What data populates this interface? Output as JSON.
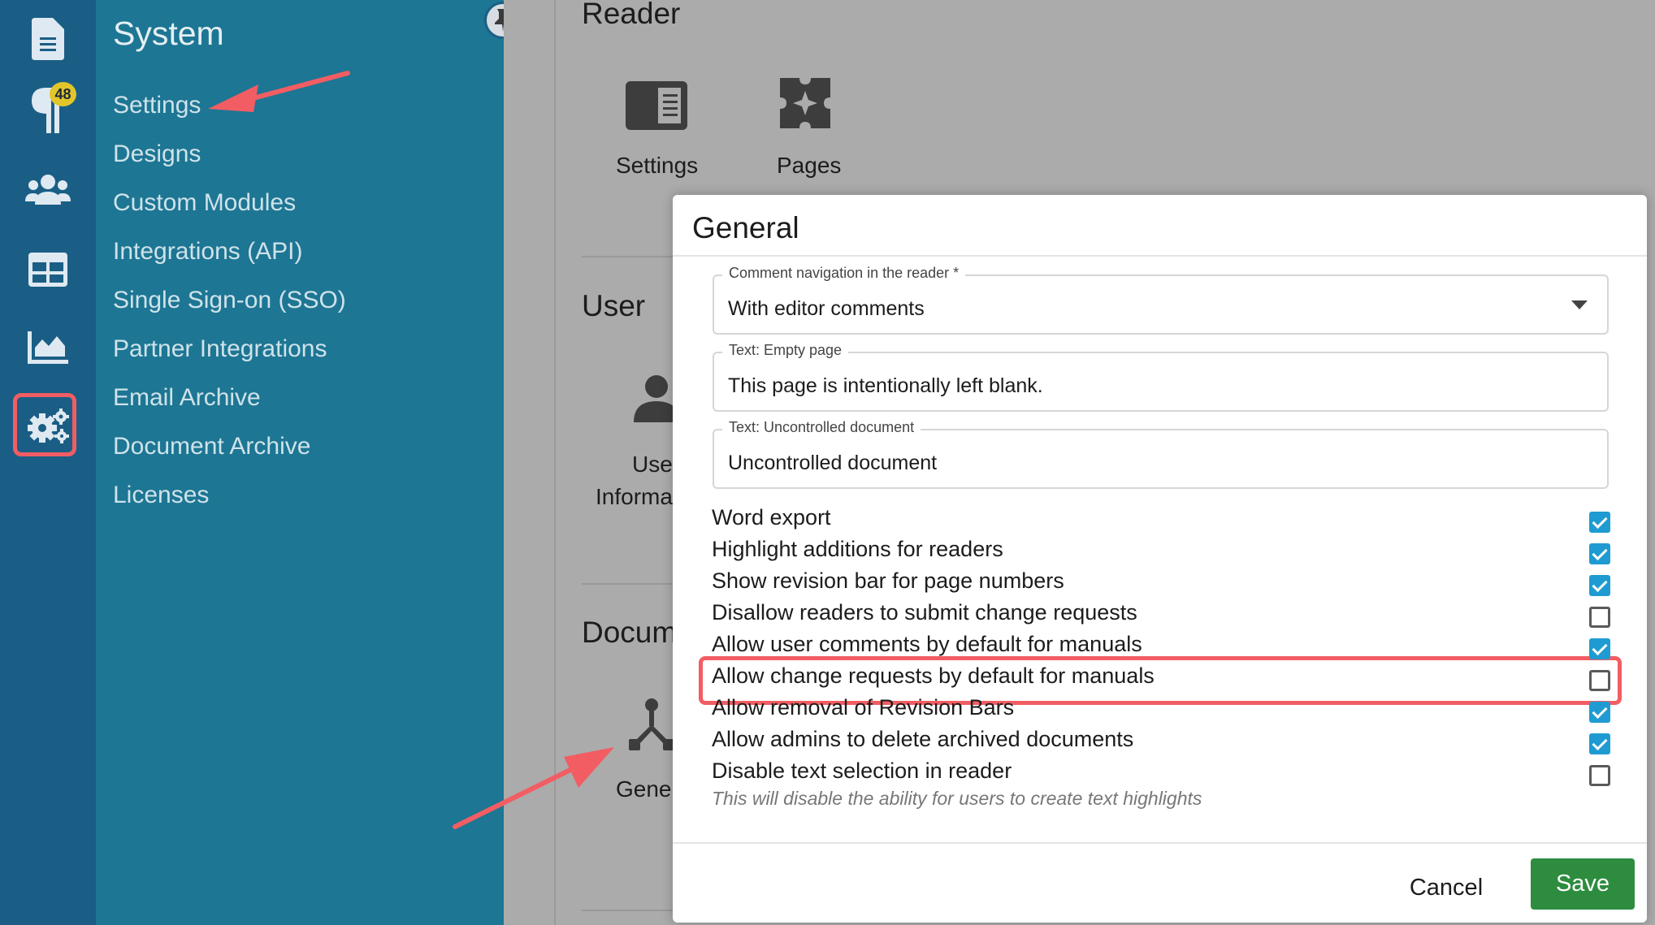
{
  "rail": {
    "notification_count": "48",
    "items": [
      {
        "name": "documents-icon"
      },
      {
        "name": "change-requests-icon"
      },
      {
        "name": "users-icon"
      },
      {
        "name": "tables-icon"
      },
      {
        "name": "analytics-icon"
      },
      {
        "name": "system-settings-icon"
      }
    ]
  },
  "menu": {
    "title": "System",
    "items": [
      "Settings",
      "Designs",
      "Custom Modules",
      "Integrations (API)",
      "Single Sign-on (SSO)",
      "Partner Integrations",
      "Email Archive",
      "Document Archive",
      "Licenses"
    ]
  },
  "background": {
    "reader_heading": "Reader",
    "reader_tiles": [
      "Settings",
      "Pages"
    ],
    "user_heading": "User",
    "user_tile_line1": "User",
    "user_tile_line2": "Informa",
    "document_heading": "Docum",
    "general_tile": "Gener"
  },
  "dialog": {
    "title": "General",
    "fields": [
      {
        "label": "Comment navigation in the reader *",
        "value": "With editor comments",
        "type": "select"
      },
      {
        "label": "Text: Empty page",
        "value": "This page is intentionally left blank.",
        "type": "text"
      },
      {
        "label": "Text: Uncontrolled document",
        "value": "Uncontrolled document",
        "type": "text"
      }
    ],
    "options": [
      {
        "label": "Word export",
        "checked": true
      },
      {
        "label": "Highlight additions for readers",
        "checked": true
      },
      {
        "label": "Show revision bar for page numbers",
        "checked": true
      },
      {
        "label": "Disallow readers to submit change requests",
        "checked": false
      },
      {
        "label": "Allow user comments by default for manuals",
        "checked": true
      },
      {
        "label": "Allow change requests by default for manuals",
        "checked": false
      },
      {
        "label": "Allow removal of Revision Bars",
        "checked": true
      },
      {
        "label": "Allow admins to delete archived documents",
        "checked": true
      },
      {
        "label": "Disable text selection in reader",
        "checked": false
      }
    ],
    "hint": "This will disable the ability for users to create text highlights",
    "cancel_label": "Cancel",
    "save_label": "Save"
  },
  "colors": {
    "rail": "#1a5e86",
    "menu": "#1d7693",
    "accent_check": "#1f9bd2",
    "save": "#2e8c3f",
    "annotation": "#f25d63"
  }
}
